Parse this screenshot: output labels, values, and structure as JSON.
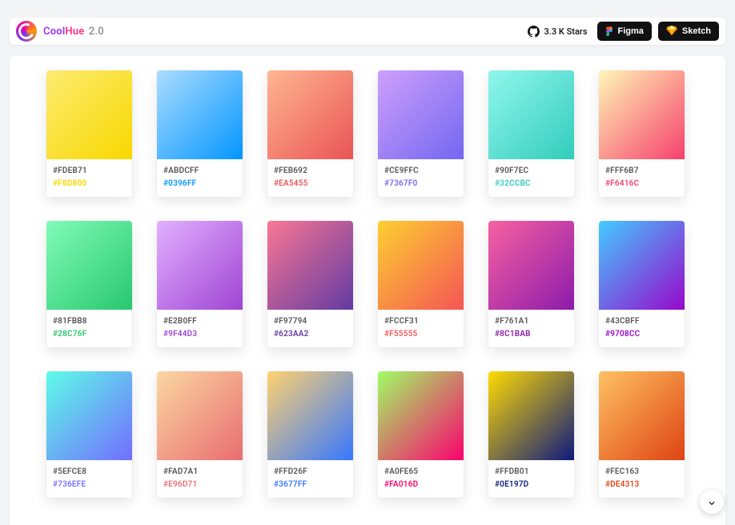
{
  "header": {
    "brand_cool": "Cool",
    "brand_hue": "Hue",
    "brand_ver": "2.0",
    "stars_label": "3.3 K Stars",
    "figma_label": "Figma",
    "sketch_label": "Sketch"
  },
  "swatches": [
    {
      "start": "#FDEB71",
      "end": "#F8D800"
    },
    {
      "start": "#ABDCFF",
      "end": "#0396FF"
    },
    {
      "start": "#FEB692",
      "end": "#EA5455"
    },
    {
      "start": "#CE9FFC",
      "end": "#7367F0"
    },
    {
      "start": "#90F7EC",
      "end": "#32CCBC"
    },
    {
      "start": "#FFF6B7",
      "end": "#F6416C"
    },
    {
      "start": "#81FBB8",
      "end": "#28C76F"
    },
    {
      "start": "#E2B0FF",
      "end": "#9F44D3"
    },
    {
      "start": "#F97794",
      "end": "#623AA2"
    },
    {
      "start": "#FCCF31",
      "end": "#F55555"
    },
    {
      "start": "#F761A1",
      "end": "#8C1BAB"
    },
    {
      "start": "#43CBFF",
      "end": "#9708CC"
    },
    {
      "start": "#5EFCE8",
      "end": "#736EFE"
    },
    {
      "start": "#FAD7A1",
      "end": "#E96D71"
    },
    {
      "start": "#FFD26F",
      "end": "#3677FF"
    },
    {
      "start": "#A0FE65",
      "end": "#FA016D"
    },
    {
      "start": "#FFDB01",
      "end": "#0E197D"
    },
    {
      "start": "#FEC163",
      "end": "#DE4313"
    }
  ]
}
